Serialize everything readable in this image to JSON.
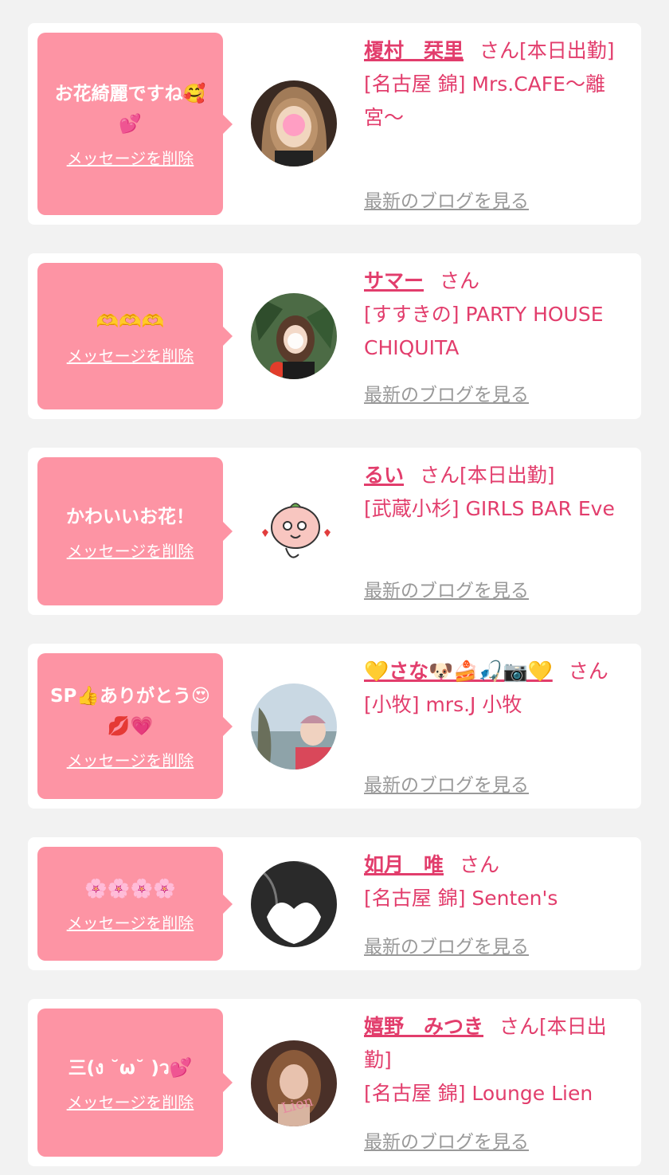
{
  "colors": {
    "accent": "#e23d6c",
    "bubble": "#fd94a4",
    "link_grey": "#999999"
  },
  "delete_label": "メッセージを削除",
  "blog_label": "最新のブログを見る",
  "honorific": "さん",
  "entries": [
    {
      "message": "お花綺麗ですね🥰💕",
      "name": "榎村　栞里",
      "status": "[本日出勤]",
      "shop": "[名古屋 錦] Mrs.CAFE〜離宮〜",
      "avatar": "photo"
    },
    {
      "message": "🫶🫶🫶",
      "name": "サマー",
      "status": "",
      "shop": "[すすきの] PARTY HOUSE CHIQUITA",
      "avatar": "photo"
    },
    {
      "message": "かわいいお花！",
      "name": "るい",
      "status": "[本日出勤]",
      "shop": "[武蔵小杉] GIRLS BAR Eve",
      "avatar": "peach-character"
    },
    {
      "message": "SP👍ありがとう😍💋💗",
      "name": "💛さな🐶🍰🎣📷💛",
      "status": "",
      "shop": "[小牧] mrs.J 小牧",
      "avatar": "photo"
    },
    {
      "message": "🌸🌸🌸🌸",
      "name": "如月　唯",
      "status": "",
      "shop": "[名古屋 錦] Senten's",
      "avatar": "heart-photo"
    },
    {
      "message": "三(ง ˘ω˘ )ว💕",
      "name": "嬉野　みつき",
      "status": "[本日出勤]",
      "shop": "[名古屋 錦] Lounge Lien",
      "avatar": "photo"
    }
  ]
}
